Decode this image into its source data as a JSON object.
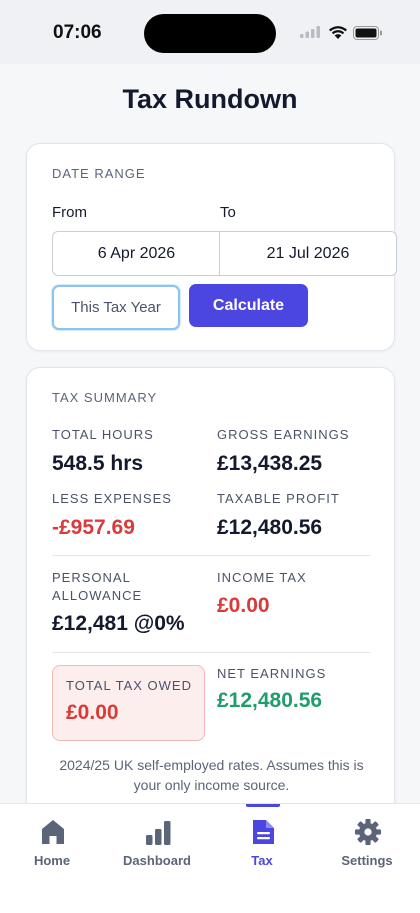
{
  "status": {
    "time": "07:06"
  },
  "title": "Tax Rundown",
  "date_range": {
    "section_label": "DATE RANGE",
    "from_label": "From",
    "to_label": "To",
    "from_value": "6 Apr 2026",
    "to_value": "21 Jul 2026",
    "tax_year_button": "This Tax Year",
    "calculate_button": "Calculate"
  },
  "summary": {
    "section_label": "TAX SUMMARY",
    "total_hours_label": "TOTAL HOURS",
    "total_hours_value": "548.5 hrs",
    "gross_earnings_label": "GROSS EARNINGS",
    "gross_earnings_value": "£13,438.25",
    "less_expenses_label": "LESS EXPENSES",
    "less_expenses_value": "-£957.69",
    "taxable_profit_label": "TAXABLE PROFIT",
    "taxable_profit_value": "£12,480.56",
    "personal_allowance_label_1": "PERSONAL",
    "personal_allowance_label_2": "ALLOWANCE",
    "personal_allowance_value": "£12,481 @0%",
    "income_tax_label": "INCOME TAX",
    "income_tax_value": "£0.00",
    "total_tax_owed_label": "TOTAL TAX OWED",
    "total_tax_owed_value": "£0.00",
    "net_earnings_label": "NET EARNINGS",
    "net_earnings_value": "£12,480.56",
    "note_line_1": "2024/25 UK self-employed rates. Assumes this is",
    "note_line_2": "your only income source."
  },
  "tabs": [
    {
      "label": "Home",
      "icon": "home-icon"
    },
    {
      "label": "Dashboard",
      "icon": "bar-chart-icon"
    },
    {
      "label": "Tax",
      "icon": "document-icon",
      "active": true
    },
    {
      "label": "Settings",
      "icon": "gear-icon"
    }
  ],
  "colors": {
    "accent": "#4b46e0",
    "negative": "#d93b3b",
    "positive": "#1f9d6a"
  }
}
